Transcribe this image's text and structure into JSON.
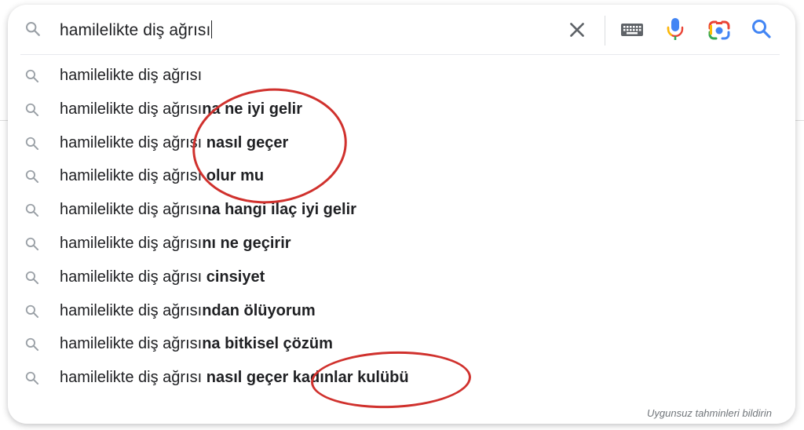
{
  "search": {
    "query": "hamilelikte diş ağrısı",
    "icons": {
      "leading": "search-icon",
      "clear": "close-icon",
      "keyboard": "keyboard-icon",
      "voice": "mic-icon",
      "image": "camera-lens-icon",
      "submit": "search-icon"
    }
  },
  "suggestions": [
    {
      "base": "hamilelikte diş ağrısı",
      "completion": ""
    },
    {
      "base": "hamilelikte diş ağrısı",
      "completion": "na ne iyi gelir"
    },
    {
      "base": "hamilelikte diş ağrısı ",
      "completion": "nasıl geçer"
    },
    {
      "base": "hamilelikte diş ağrısı ",
      "completion": "olur mu"
    },
    {
      "base": "hamilelikte diş ağrısı",
      "completion": "na hangi ilaç iyi gelir"
    },
    {
      "base": "hamilelikte diş ağrısı",
      "completion": "nı ne geçirir"
    },
    {
      "base": "hamilelikte diş ağrısı ",
      "completion": "cinsiyet"
    },
    {
      "base": "hamilelikte diş ağrısı",
      "completion": "ndan ölüyorum"
    },
    {
      "base": "hamilelikte diş ağrısı",
      "completion": "na bitkisel çözüm"
    },
    {
      "base": "hamilelikte diş ağrısı ",
      "completion": "nasıl geçer kadınlar kulübü"
    }
  ],
  "footer": {
    "report_label": "Uygunsuz tahminleri bildirin"
  },
  "colors": {
    "text": "#202124",
    "icon_gray": "#9aa0a6",
    "annotation": "#d0312d",
    "google_blue": "#4285f4",
    "google_red": "#ea4335",
    "google_yellow": "#fbbc04",
    "google_green": "#34a853"
  }
}
